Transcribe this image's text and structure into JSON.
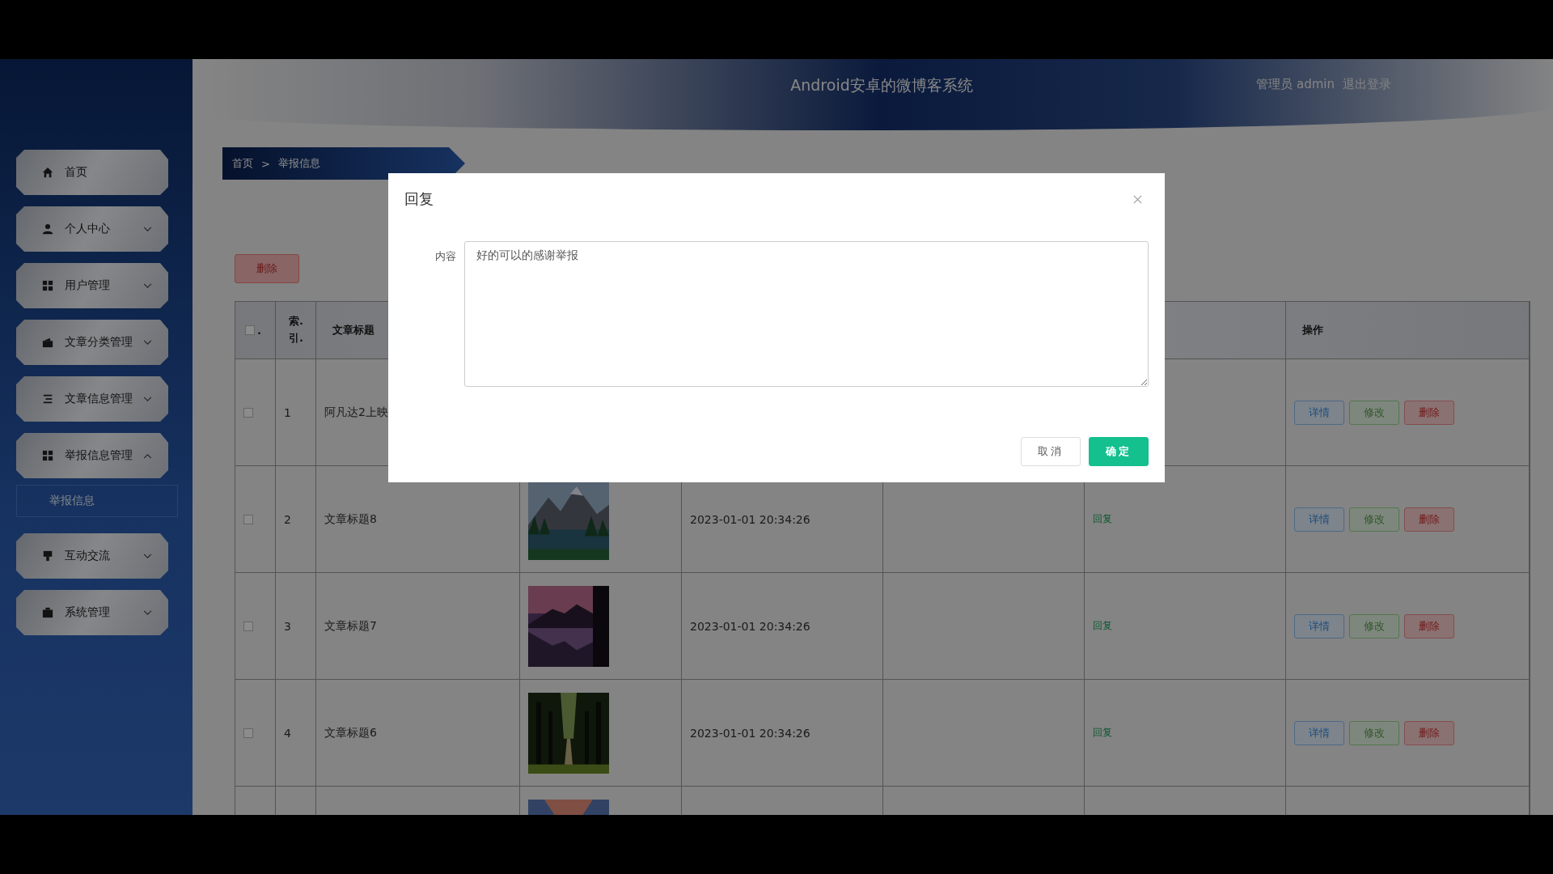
{
  "header": {
    "title": "Android安卓的微博客系统",
    "user": "管理员 admin",
    "logout": "退出登录"
  },
  "sidebar": {
    "items": [
      {
        "label": "首页"
      },
      {
        "label": "个人中心",
        "expanded": false
      },
      {
        "label": "用户管理",
        "expanded": false
      },
      {
        "label": "文章分类管理",
        "expanded": false
      },
      {
        "label": "文章信息管理",
        "expanded": false
      },
      {
        "label": "举报信息管理",
        "expanded": true,
        "children": [
          {
            "label": "举报信息"
          }
        ]
      },
      {
        "label": "互动交流",
        "expanded": false
      },
      {
        "label": "系统管理",
        "expanded": false
      }
    ]
  },
  "breadcrumb": {
    "items": [
      "首页",
      "举报信息"
    ],
    "separator": ">"
  },
  "toolbar": {
    "delete_button": "删除"
  },
  "table": {
    "columns": [
      {
        "kind": "checkbox",
        "label": ".",
        "checked": false
      },
      {
        "label": "索.引."
      },
      {
        "label": "文章标题"
      },
      {
        "label": "操作"
      }
    ],
    "rows": [
      {
        "checked": false,
        "index": "1",
        "title": "阿凡达2上映",
        "ops": [
          {
            "label": "详情",
            "kind": "detail"
          },
          {
            "label": "修改",
            "kind": "edit"
          },
          {
            "label": "删除",
            "kind": "delete"
          }
        ]
      },
      {
        "checked": false,
        "index": "2",
        "title": "文章标题8",
        "image": {
          "kind": "picture"
        },
        "time": "2023-01-01 20:34:26",
        "reply": "回复",
        "ops": [
          {
            "label": "详情",
            "kind": "detail"
          },
          {
            "label": "修改",
            "kind": "edit"
          },
          {
            "label": "删除",
            "kind": "delete"
          }
        ]
      },
      {
        "checked": false,
        "index": "3",
        "title": "文章标题7",
        "image": {
          "kind": "picture"
        },
        "time": "2023-01-01 20:34:26",
        "reply": "回复",
        "ops": [
          {
            "label": "详情",
            "kind": "detail"
          },
          {
            "label": "修改",
            "kind": "edit"
          },
          {
            "label": "删除",
            "kind": "delete"
          }
        ]
      },
      {
        "checked": false,
        "index": "4",
        "title": "文章标题6",
        "image": {
          "kind": "picture"
        },
        "time": "2023-01-01 20:34:26",
        "reply": "回复",
        "ops": [
          {
            "label": "详情",
            "kind": "detail"
          },
          {
            "label": "修改",
            "kind": "edit"
          },
          {
            "label": "删除",
            "kind": "delete"
          }
        ]
      },
      {
        "image": {
          "kind": "picture"
        }
      }
    ]
  },
  "dialog": {
    "title": "回复",
    "field_label": "内容",
    "value": "好的可以的感谢举报",
    "buttons": [
      {
        "label": "取消",
        "kind": "default"
      },
      {
        "label": "确定",
        "kind": "primary"
      }
    ]
  }
}
